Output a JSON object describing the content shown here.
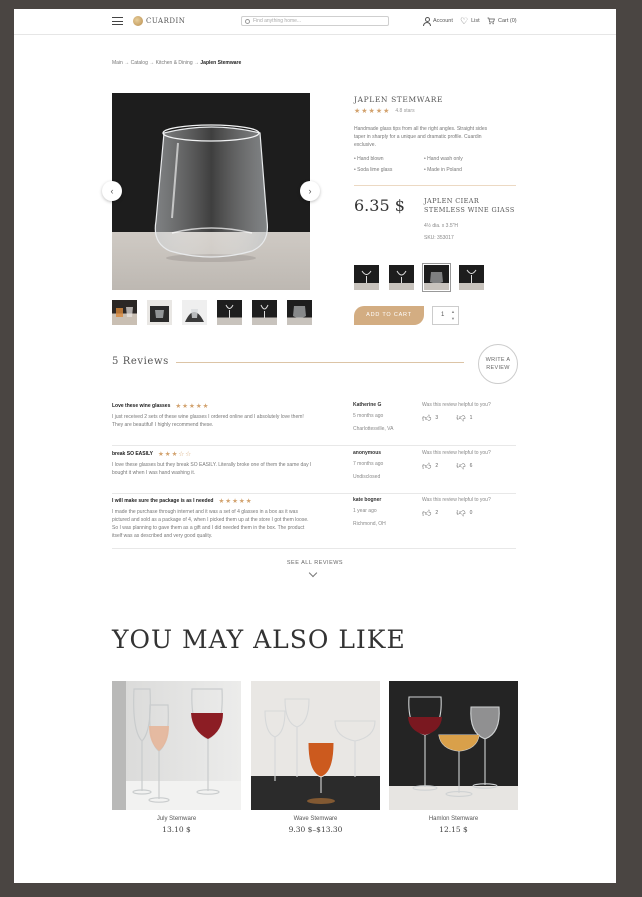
{
  "header": {
    "logo": "CUARDIN",
    "search_placeholder": "Find anything home...",
    "account": "Account",
    "list": "List",
    "cart": "Cart (0)"
  },
  "breadcrumb": {
    "items": [
      "Main",
      "Catalog",
      "Kitchen & Dining"
    ],
    "current": "Japlen Stemware"
  },
  "product": {
    "title": "JAPLEN STEMWARE",
    "rating_stars": "★★★★★",
    "rating_text": "4.8 stars",
    "description": "Handmade glass tips from all the right angles. Straight sides taper in sharply for a unique and dramatic profile. Cuardin exclusive.",
    "features": [
      "Hand blown",
      "Hand wash only",
      "Soda lime glass",
      "Made in Poland"
    ],
    "price": "6.35 $",
    "variant_name": "JAPLEN CIEAR STEMLESS WINE GIASS",
    "variant_size": "4½ dia. x 3.5\"H",
    "variant_sku": "SKU: 353017",
    "add_to_cart": "ADD TO CART",
    "quantity": "1",
    "qty_up": "▲",
    "qty_down": "▼",
    "prev_icon": "‹",
    "next_icon": "›"
  },
  "reviews": {
    "title": "5 Reviews",
    "write_label_1": "WRITE A",
    "write_label_2": "REVIEW",
    "helpful_label": "Was this review helpful to you?",
    "items": [
      {
        "title": "Love these wine glasses",
        "stars": "★★★★★",
        "body": "I just received 2 sets of these wine glasses I ordered online and I absolutely love them! They are beautiful! I highly recommend these.",
        "author": "Katherine G",
        "time": "5 months ago",
        "location": "Charlottesville, VA",
        "up": "3",
        "down": "1"
      },
      {
        "title": "break SO EASILY",
        "stars": "★★★☆☆",
        "body": "I love these glasses but they break SO EASILY. Literally broke one of them the same day I bought it when I was hand washing it.",
        "author": "anonymous",
        "time": "7 months ago",
        "location": "Undisclosed",
        "up": "2",
        "down": "6"
      },
      {
        "title": "I will make sure the package is as I needed",
        "stars": "★★★★★",
        "body": "I made the purchase through internet and it was a set of 4 glasses in a box as it was pictured and sold as a package of 4, when I picked them up at the store I got them loose. So I was planning to gave them as a gift and I did needed them in the box. The product itself was as described and very good quality.",
        "author": "kate bogner",
        "time": "1 year ago",
        "location": "Richmond, OH",
        "up": "2",
        "down": "0"
      }
    ],
    "see_all": "SEE ALL REVIEWS"
  },
  "also_like": {
    "title": "YOU MAY ALSO LIKE",
    "items": [
      {
        "name": "July Stemware",
        "price": "13.10 $"
      },
      {
        "name": "Wave Stemware",
        "price": "9.30 $–$13.30"
      },
      {
        "name": "Hamlon Stemware",
        "price": "12.15 $"
      }
    ]
  },
  "colors": {
    "accent_gold": "#d3ad82",
    "star_gold": "#d2a26e",
    "frame_bg": "#4a4542"
  },
  "icons": [
    "menu-icon",
    "search-icon",
    "account-icon",
    "heart-icon",
    "cart-icon",
    "chevron-left-icon",
    "chevron-right-icon",
    "thumbs-up-icon",
    "thumbs-down-icon",
    "chevron-down-icon"
  ]
}
